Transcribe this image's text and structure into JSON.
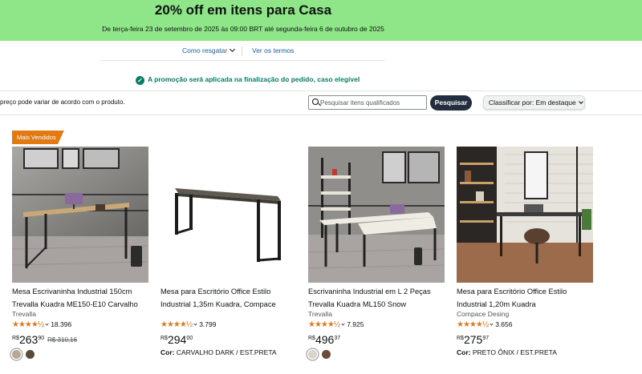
{
  "banner": {
    "title": "20% off em itens para Casa",
    "subtitle": "De terça-feira 23 de setembro de 2025 às 09:00 BRT até segunda-feira 6 de outubro de 2025",
    "bg_color": "#8ee688"
  },
  "links": {
    "how_to": "Como resgatar",
    "terms": "Ver os termos"
  },
  "notice": "A promoção será aplicada na finalização do pedido, caso elegível",
  "note": "preço pode variar de acordo com o produto.",
  "search": {
    "placeholder": "Pesquisar itens qualificados",
    "button": "Pesquisar"
  },
  "sort": {
    "label": "Classificar por:",
    "value": "Em destaque"
  },
  "badge": "Mais Vendidos",
  "colors": {
    "badge": "#e47911",
    "link": "#2162a1",
    "stars": "#de7921",
    "success": "#067d62",
    "dark_button": "#232f3e"
  },
  "products": [
    {
      "title_1": "Mesa Escrivaninha Industrial 150cm",
      "title_2": "Trevalla Kuadra ME150-E10 Carvalho",
      "brand": "Trevalla",
      "stars": "★★★★½",
      "rating_count": "18.396",
      "currency": "R$",
      "price_whole": "263",
      "price_cents": "90",
      "price_old": "R$ 310,16",
      "swatches": [
        "#b7a98f",
        "#5a4a3c"
      ],
      "color_label": "",
      "color_value": ""
    },
    {
      "title_1": "Mesa para Escritório Office Estilo",
      "title_2": "Industrial 1,35m Kuadra, Compace",
      "brand": "",
      "stars": "★★★★½",
      "rating_count": "3.799",
      "currency": "R$",
      "price_whole": "294",
      "price_cents": "00",
      "price_old": "",
      "swatches": [],
      "color_label": "Cor:",
      "color_value": "CARVALHO DARK / EST.PRETA"
    },
    {
      "title_1": "Escrivaninha Industrial em L 2 Peças",
      "title_2": "Trevalla Kuadra ML150 Snow",
      "brand": "Trevalla",
      "stars": "★★★★½",
      "rating_count": "7.925",
      "currency": "R$",
      "price_whole": "496",
      "price_cents": "37",
      "price_old": "",
      "swatches": [
        "#d8d4c8",
        "#6b4a38"
      ],
      "color_label": "",
      "color_value": ""
    },
    {
      "title_1": "Mesa para Escritório Office Estilo",
      "title_2": "Industrial 1,20m Kuadra",
      "brand": "Compace Desing",
      "stars": "★★★★½",
      "rating_count": "3.656",
      "currency": "R$",
      "price_whole": "275",
      "price_cents": "97",
      "price_old": "",
      "swatches": [],
      "color_label": "Cor:",
      "color_value": "PRETO ÔNIX / EST.PRETA"
    }
  ]
}
